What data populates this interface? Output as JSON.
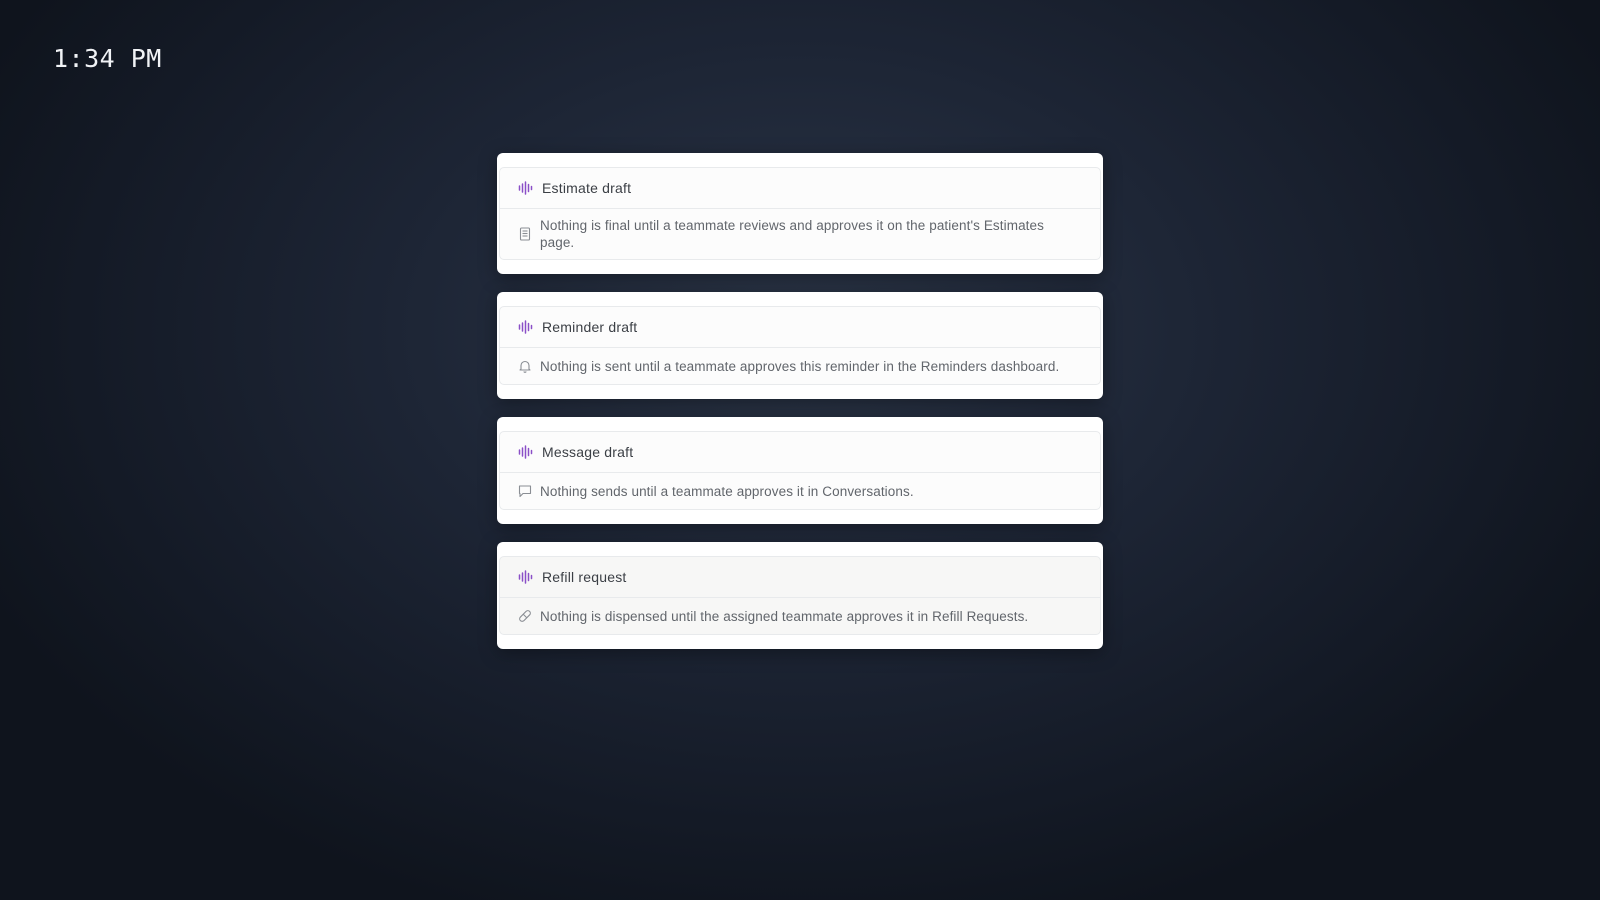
{
  "clock": {
    "time": "1:34 PM"
  },
  "colors": {
    "accent": "#8a4fc7",
    "icon_muted": "#8a8e94"
  },
  "cards": [
    {
      "title": "Estimate draft",
      "title_icon": "audio-wave-icon",
      "note_icon": "document-icon",
      "note": "Nothing is final until a teammate reviews and approves it on the patient's Estimates page."
    },
    {
      "title": "Reminder draft",
      "title_icon": "audio-wave-icon",
      "note_icon": "bell-icon",
      "note": "Nothing is sent until a teammate approves this reminder in the Reminders dashboard."
    },
    {
      "title": "Message draft",
      "title_icon": "audio-wave-icon",
      "note_icon": "chat-bubble-icon",
      "note": "Nothing sends until a teammate approves it in Conversations."
    },
    {
      "title": "Refill request",
      "title_icon": "audio-wave-icon",
      "note_icon": "pill-icon",
      "note": "Nothing is dispensed until the assigned teammate approves it in Refill Requests."
    }
  ]
}
